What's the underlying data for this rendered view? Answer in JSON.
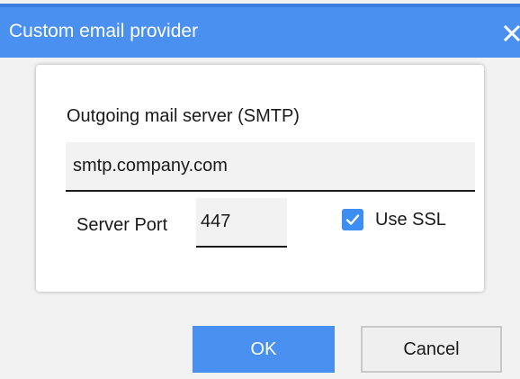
{
  "dialog": {
    "title": "Custom email provider",
    "close_icon": "close-icon"
  },
  "form": {
    "smtp_label": "Outgoing mail server (SMTP)",
    "smtp_value": "smtp.company.com",
    "port_label": "Server Port",
    "port_value": "447",
    "ssl_label": "Use SSL",
    "ssl_checked": true,
    "checkbox_icon": "checkmark-icon"
  },
  "buttons": {
    "ok_label": "OK",
    "cancel_label": "Cancel"
  },
  "colors": {
    "titlebar": "#4a90f0",
    "accent": "#3c8ef2",
    "ok_button": "#4a90f0",
    "dialog_background": "#f2f2f2"
  }
}
